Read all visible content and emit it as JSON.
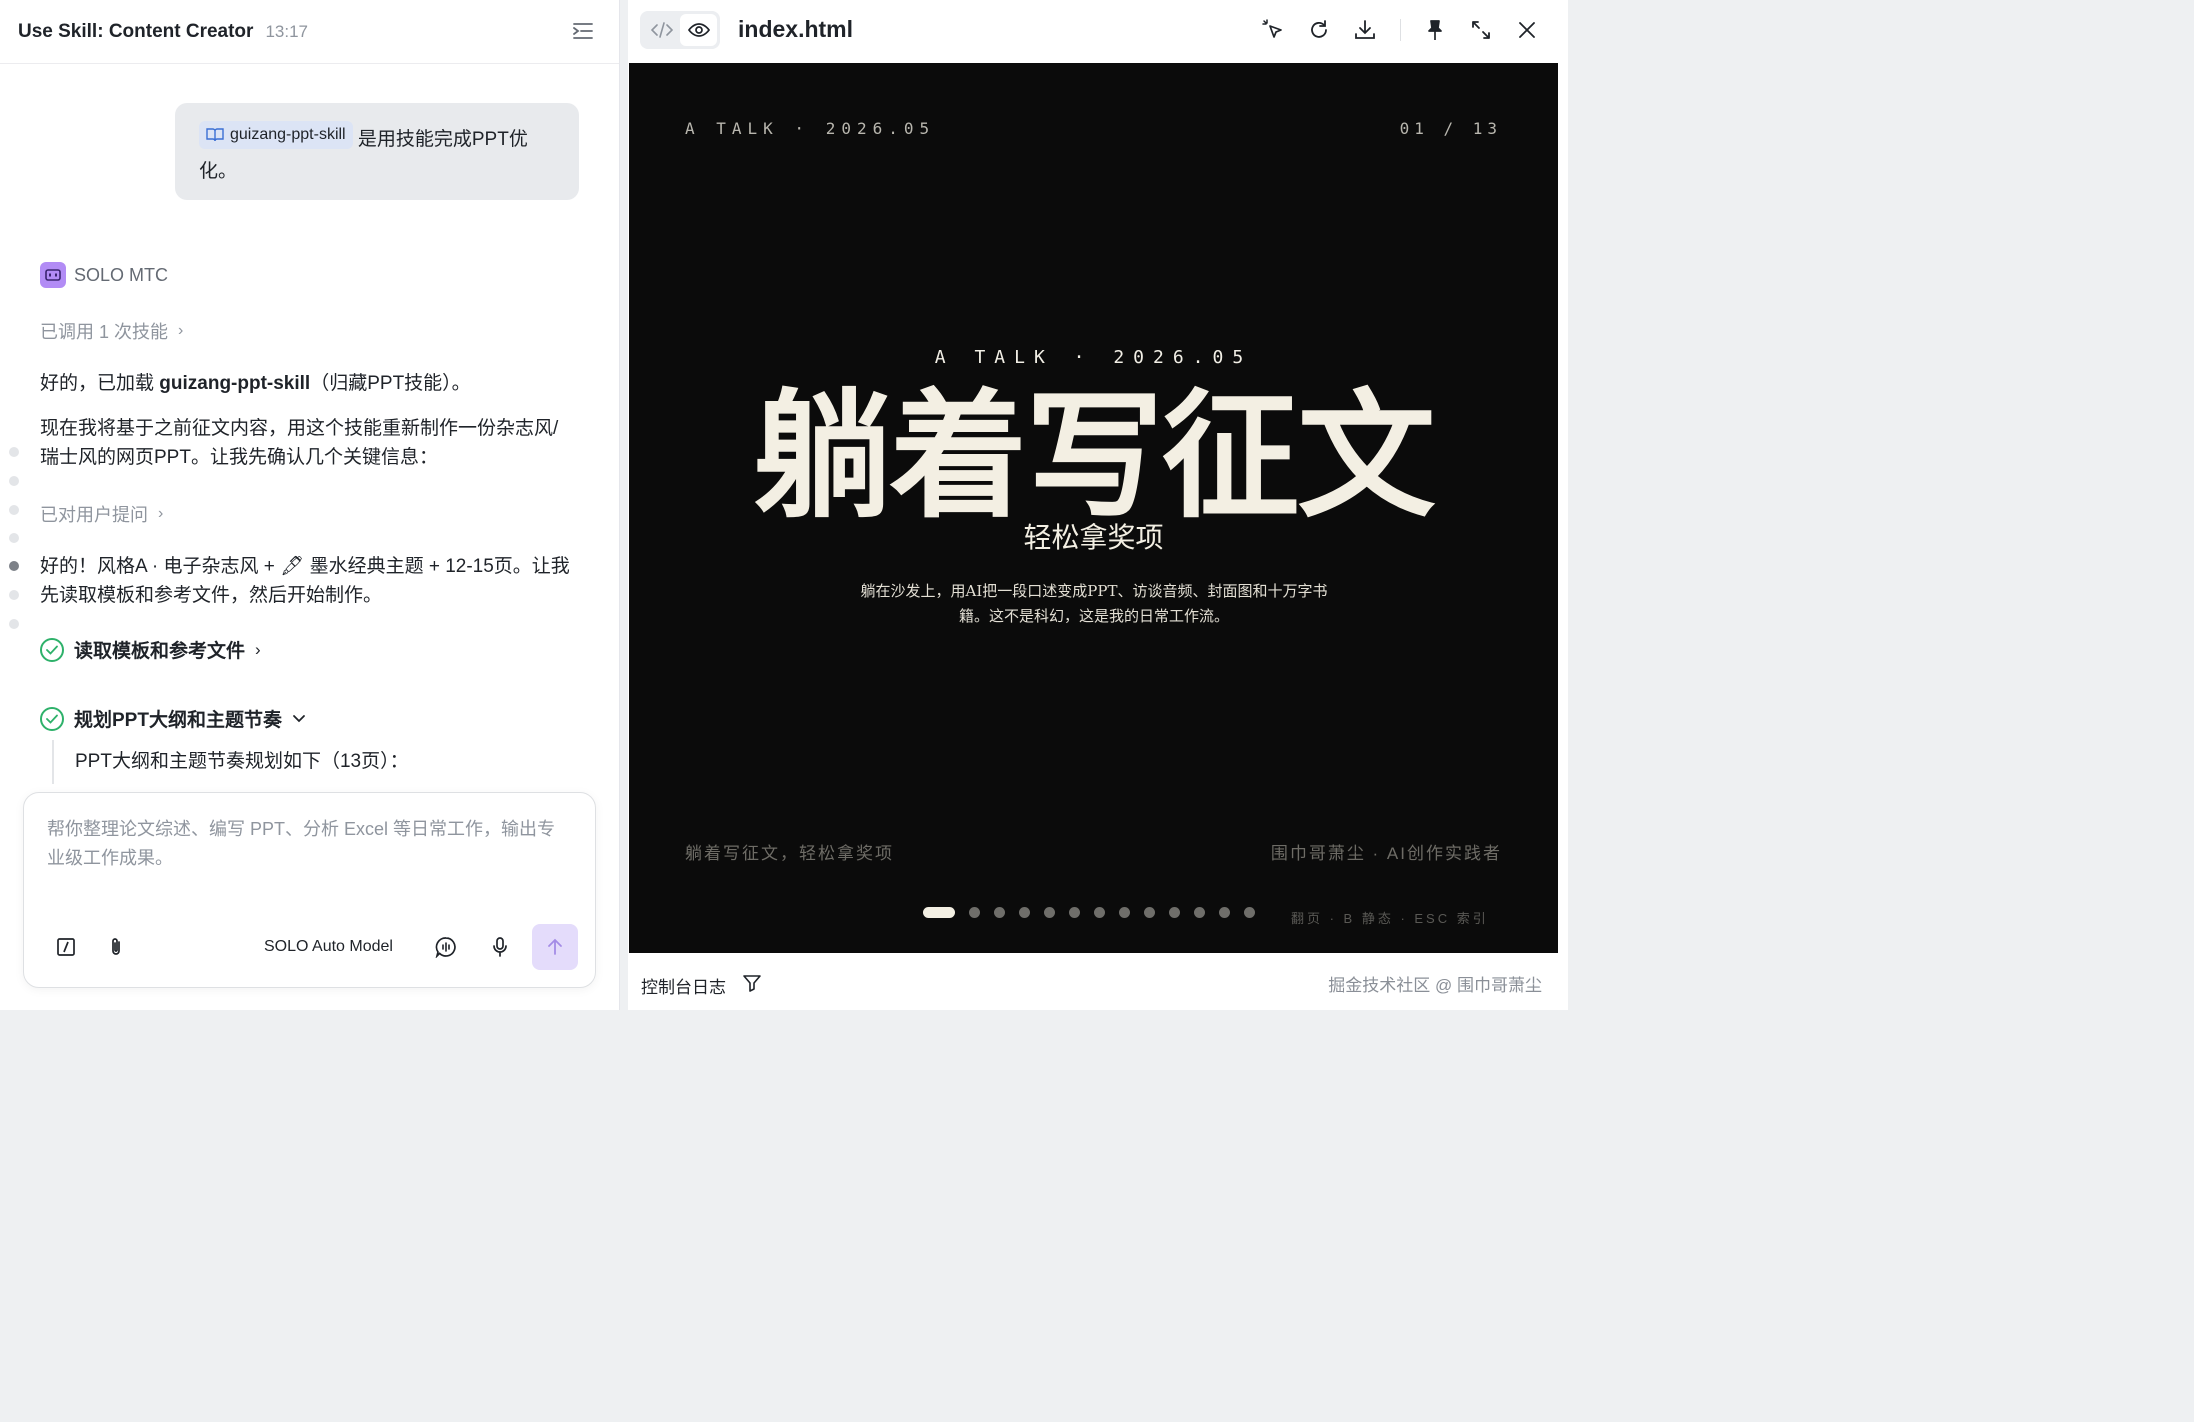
{
  "left_panel": {
    "title": "Use Skill: Content Creator",
    "time": "13:17",
    "user_message": {
      "skill_chip": "guizang-ppt-skill",
      "text": " 是用技能完成PPT优化。"
    },
    "bot": {
      "name": "SOLO MTC",
      "skill_calls": "已调用 1 次技能",
      "msg1_prefix": "好的，已加载 ",
      "msg1_bold": "guizang-ppt-skill",
      "msg1_suffix": "（归藏PPT技能）。",
      "msg2": "现在我将基于之前征文内容，用这个技能重新制作一份杂志风/瑞士风的网页PPT。让我先确认几个关键信息：",
      "asked_user": "已对用户提问",
      "msg3": "好的！风格A · 电子杂志风 + 🖋 墨水经典主题 + 12-15页。让我先读取模板和参考文件，然后开始制作。",
      "task1": "读取模板和参考文件",
      "task2": "规划PPT大纲和主题节奏",
      "task2_detail": "PPT大纲和主题节奏规划如下（13页）："
    },
    "composer": {
      "placeholder": "帮你整理论文综述、编写 PPT、分析 Excel 等日常工作，输出专业级工作成果。",
      "model": "SOLO Auto Model"
    }
  },
  "right_panel": {
    "file_name": "index.html",
    "slide": {
      "top_left": "A TALK · 2026.05",
      "page_indicator": "01 / 13",
      "kicker": "A TALK · 2026.05",
      "title": "躺着写征文",
      "subtitle": "轻松拿奖项",
      "description": "躺在沙发上，用AI把一段口述变成PPT、访谈音频、封面图和十万字书籍。这不是科幻，这是我的日常工作流。",
      "footer_left": "躺着写征文，轻松拿奖项",
      "footer_right": "围巾哥萧尘 · AI创作实践者",
      "hint": "翻页 · B 静态 · ESC 索引",
      "current_page": 1,
      "total_pages": 13
    },
    "console_label": "控制台日志",
    "watermark": "掘金技术社区 @ 围巾哥萧尘"
  },
  "colors": {
    "slide_bg": "#0b0b0b",
    "slide_text": "#f3efe3",
    "accent_purple": "#b28cf5",
    "success_green": "#2eb16a"
  }
}
